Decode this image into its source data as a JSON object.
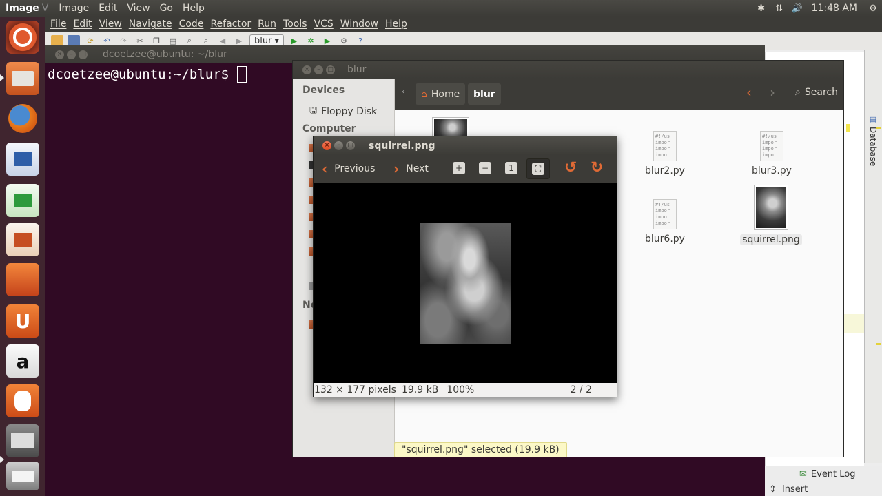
{
  "top_panel": {
    "app_title": "Image",
    "app_title_fade": "V",
    "menus": [
      "Image",
      "Edit",
      "View",
      "Go",
      "Help"
    ],
    "tray_icons": [
      "bluetooth-icon",
      "network-icon",
      "volume-icon"
    ],
    "clock": "11:48 AM"
  },
  "launcher": {
    "items": [
      "ubuntu-dash",
      "files",
      "firefox",
      "writer",
      "calc",
      "impress",
      "software-center",
      "ubuntu-one",
      "amazon",
      "ubuntu-one-music",
      "system-settings",
      "printer"
    ]
  },
  "ide": {
    "menus": [
      "File",
      "Edit",
      "View",
      "Navigate",
      "Code",
      "Refactor",
      "Run",
      "Tools",
      "VCS",
      "Window",
      "Help"
    ],
    "run_config": "blur",
    "right_tab": "Database",
    "event_log": "Event Log",
    "mode": "Insert"
  },
  "terminal": {
    "title": "dcoetzee@ubuntu: ~/blur",
    "prompt": "dcoetzee@ubuntu:~/blur$"
  },
  "files": {
    "title": "blur",
    "sidebar": {
      "devices_header": "Devices",
      "floppy": "Floppy Disk",
      "computer_header": "Computer",
      "network_header": "Ne"
    },
    "breadcrumb": {
      "home": "Home",
      "current": "blur"
    },
    "search": "Search",
    "items": [
      {
        "name": "blur2.py",
        "preview": [
          "#!/us",
          "impor",
          "impor",
          "impor"
        ]
      },
      {
        "name": "blur3.py",
        "preview": [
          "#!/us",
          "impor",
          "impor",
          "impor"
        ]
      },
      {
        "name": "blur6.py",
        "preview": [
          "#!/us",
          "impor",
          "impor",
          "impor"
        ]
      },
      {
        "name": "squirrel.png",
        "preview": []
      }
    ],
    "status": "\"squirrel.png\" selected (19.9 kB)"
  },
  "viewer": {
    "title": "squirrel.png",
    "previous": "Previous",
    "next": "Next",
    "dimensions": "132 × 177 pixels",
    "size": "19.9 kB",
    "zoom": "100%",
    "position": "2 / 2"
  }
}
